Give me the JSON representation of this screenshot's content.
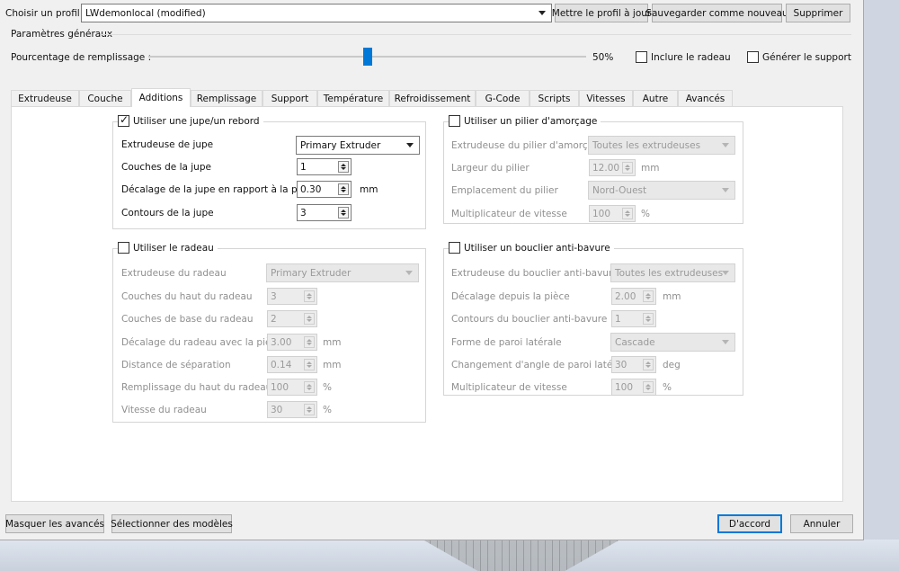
{
  "profile": {
    "label": "Choisir un profil :",
    "selected": "LWdemonlocal (modified)",
    "update_button": "Mettre le profil à jour",
    "save_new_button": "Sauvegarder comme nouveau",
    "delete_button": "Supprimer"
  },
  "general": {
    "group_title": "Paramètres généraux",
    "infill_label": "Pourcentage de remplissage :",
    "infill_value_text": "50%",
    "infill_percent": 50,
    "raft_label": "Inclure le radeau",
    "support_label": "Générer le support"
  },
  "tabs": [
    {
      "label": "Extrudeuse"
    },
    {
      "label": "Couche"
    },
    {
      "label": "Additions"
    },
    {
      "label": "Remplissage"
    },
    {
      "label": "Support"
    },
    {
      "label": "Température"
    },
    {
      "label": "Refroidissement"
    },
    {
      "label": "G-Code"
    },
    {
      "label": "Scripts"
    },
    {
      "label": "Vitesses"
    },
    {
      "label": "Autre"
    },
    {
      "label": "Avancés"
    }
  ],
  "skirt": {
    "title": "Utiliser une jupe/un rebord",
    "extruder_label": "Extrudeuse de jupe",
    "extruder_value": "Primary Extruder",
    "layers_label": "Couches de la jupe",
    "layers_value": "1",
    "offset_label": "Décalage de la jupe en rapport à la pièce",
    "offset_value": "0.30",
    "offset_unit": "mm",
    "outlines_label": "Contours de la jupe",
    "outlines_value": "3"
  },
  "prime": {
    "title": "Utiliser un pilier d'amorçage",
    "extruder_label": "Extrudeuse du pilier d'amorçage",
    "extruder_value": "Toutes les extrudeuses",
    "width_label": "Largeur du pilier",
    "width_value": "12.00",
    "width_unit": "mm",
    "location_label": "Emplacement du pilier",
    "location_value": "Nord-Ouest",
    "speed_label": "Multiplicateur de vitesse",
    "speed_value": "100",
    "speed_unit": "%"
  },
  "raft": {
    "title": "Utiliser le radeau",
    "extruder_label": "Extrudeuse du radeau",
    "extruder_value": "Primary Extruder",
    "top_layers_label": "Couches du haut du radeau",
    "top_layers_value": "3",
    "base_layers_label": "Couches de base du radeau",
    "base_layers_value": "2",
    "offset_label": "Décalage du radeau avec la pièce",
    "offset_value": "3.00",
    "offset_unit": "mm",
    "separation_label": "Distance de séparation",
    "separation_value": "0.14",
    "separation_unit": "mm",
    "top_infill_label": "Remplissage du haut du radeau",
    "top_infill_value": "100",
    "top_infill_unit": "%",
    "speed_label": "Vitesse du radeau",
    "speed_value": "30",
    "speed_unit": "%"
  },
  "ooze": {
    "title": "Utiliser un bouclier anti-bavure",
    "extruder_label": "Extrudeuse du bouclier anti-bavure",
    "extruder_value": "Toutes les extrudeuses",
    "offset_label": "Décalage depuis la pièce",
    "offset_value": "2.00",
    "offset_unit": "mm",
    "outlines_label": "Contours du bouclier anti-bavure",
    "outlines_value": "1",
    "shape_label": "Forme de paroi latérale",
    "shape_value": "Cascade",
    "angle_label": "Changement d'angle de paroi latérale",
    "angle_value": "30",
    "angle_unit": "deg",
    "speed_label": "Multiplicateur de vitesse",
    "speed_value": "100",
    "speed_unit": "%"
  },
  "footer": {
    "hide_advanced": "Masquer les avancés",
    "select_models": "Sélectionner des modèles",
    "ok": "D'accord",
    "cancel": "Annuler"
  }
}
